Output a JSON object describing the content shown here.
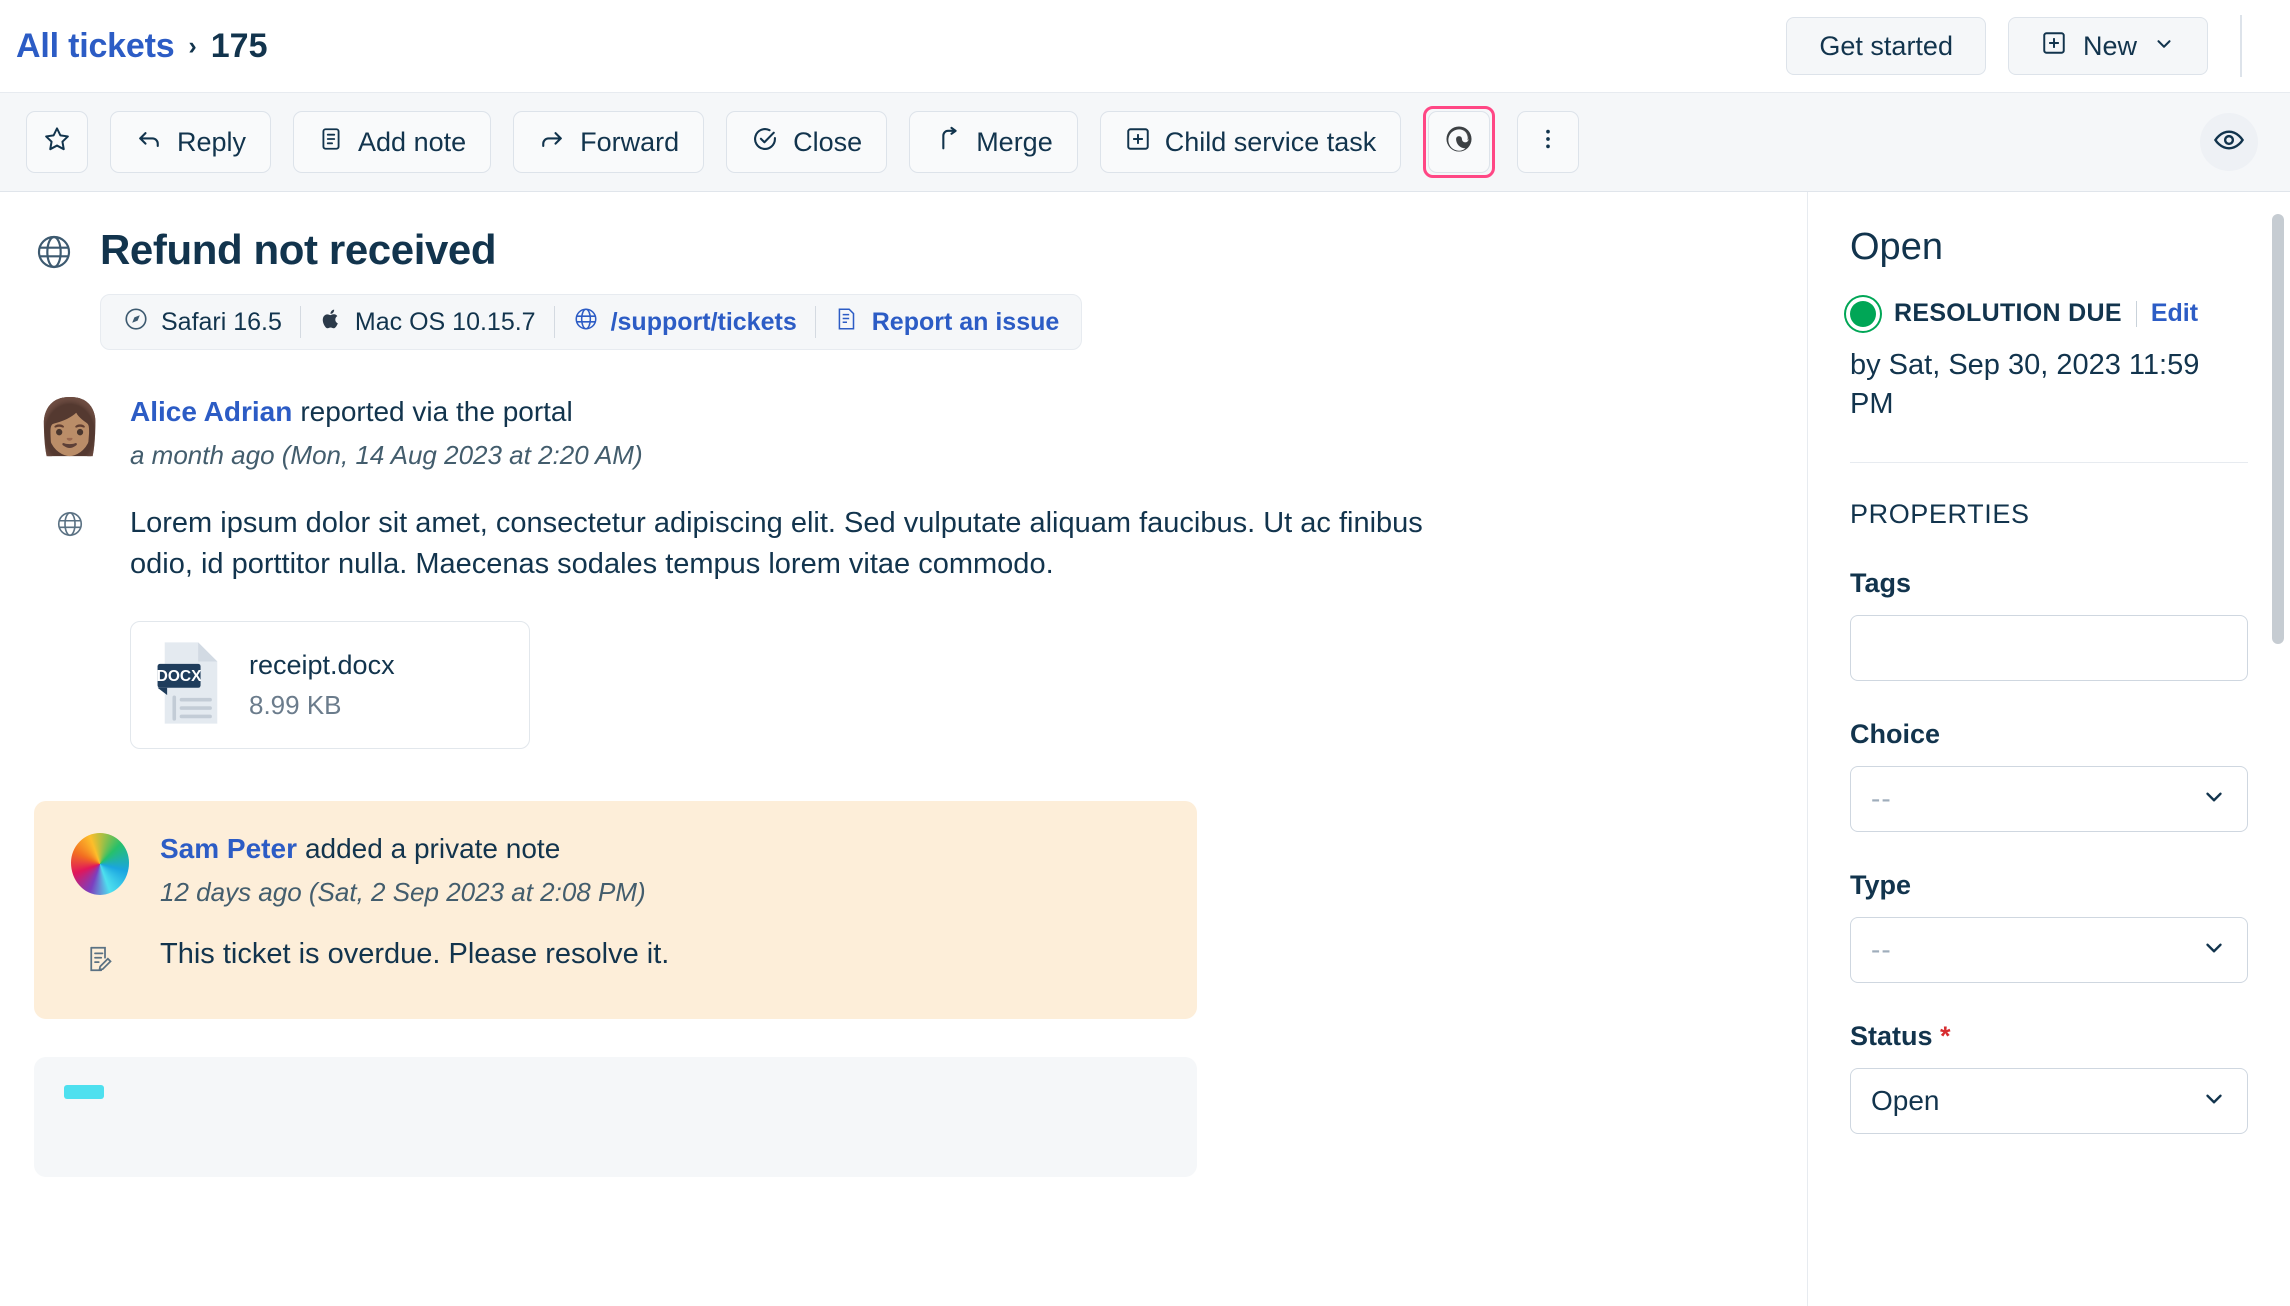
{
  "breadcrumb": {
    "root_label": "All tickets",
    "separator": "›",
    "current_label": "175"
  },
  "topbar": {
    "get_started_label": "Get started",
    "new_label": "New"
  },
  "toolbar": {
    "star_icon": "star-icon",
    "reply_label": "Reply",
    "add_note_label": "Add note",
    "forward_label": "Forward",
    "close_label": "Close",
    "merge_label": "Merge",
    "child_service_task_label": "Child service task",
    "spiral_icon": "spiral-icon",
    "more_icon": "kebab-menu-icon",
    "watch_icon": "eye-icon",
    "highlight_color": "#ff4785"
  },
  "ticket": {
    "title": "Refund not received",
    "source_icon": "globe-icon",
    "meta": [
      {
        "icon": "safari-icon",
        "label": "Safari 16.5",
        "link": false
      },
      {
        "icon": "apple-icon",
        "label": "Mac OS 10.15.7",
        "link": false
      },
      {
        "icon": "globe-icon",
        "label": "/support/tickets",
        "link": true
      },
      {
        "icon": "report-icon",
        "label": "Report an issue",
        "link": true
      }
    ]
  },
  "conversation": [
    {
      "avatar": "woman-emoji-avatar",
      "author": "Alice Adrian",
      "action": "reported via the portal",
      "timestamp": "a month ago (Mon, 14 Aug 2023 at 2:20 AM)",
      "channel_icon": "globe-icon",
      "body": "Lorem ipsum dolor sit amet, consectetur adipiscing elit. Sed vulputate aliquam faucibus. Ut ac finibus odio, id porttitor nulla. Maecenas sodales tempus lorem vitae commodo.",
      "attachment": {
        "type_label": "DOCX",
        "name": "receipt.docx",
        "size": "8.99 KB"
      }
    }
  ],
  "private_note": {
    "avatar": "freshworks-logo-avatar",
    "author": "Sam Peter",
    "action": "added a private note",
    "timestamp": "12 days ago (Sat, 2 Sep 2023 at 2:08 PM)",
    "note_icon": "note-edit-icon",
    "body": "This ticket is overdue. Please resolve it.",
    "background_color": "#fdeed9"
  },
  "sidebar": {
    "status_title": "Open",
    "sla": {
      "status_color": "#00a656",
      "label": "RESOLUTION DUE",
      "edit_label": "Edit",
      "due_text": "by Sat, Sep 30, 2023 11:59 PM"
    },
    "properties_title": "PROPERTIES",
    "fields": [
      {
        "label": "Tags",
        "type": "input",
        "value": "",
        "required": false
      },
      {
        "label": "Choice",
        "type": "select",
        "value": "--",
        "required": false,
        "placeholder": true
      },
      {
        "label": "Type",
        "type": "select",
        "value": "--",
        "required": false,
        "placeholder": true
      },
      {
        "label": "Status",
        "type": "select",
        "value": "Open",
        "required": true,
        "placeholder": false
      }
    ],
    "required_marker": "*"
  }
}
